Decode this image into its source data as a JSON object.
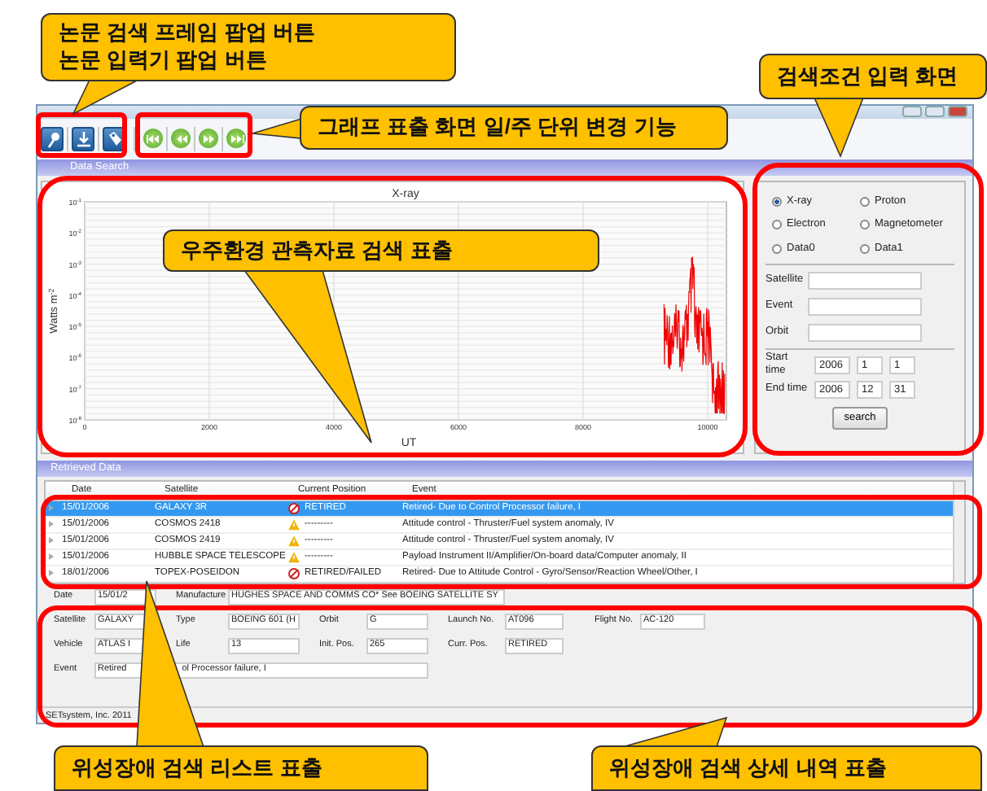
{
  "callouts": [
    {
      "lines": [
        "논문 검색 프레임 팝업 버튼",
        "논문 입력기 팝업 버튼"
      ]
    },
    {
      "lines": [
        "그래프 표출 화면 일/주 단위 변경 기능"
      ]
    },
    {
      "lines": [
        "검색조건 입력 화면"
      ]
    },
    {
      "lines": [
        "우주환경 관측자료 검색 표출"
      ]
    },
    {
      "lines": [
        "위성장애 검색 리스트 표출"
      ]
    },
    {
      "lines": [
        "위성장애 검색 상세 내역 표출"
      ]
    }
  ],
  "toolbar": [
    {
      "kind": "pin"
    },
    {
      "kind": "download"
    },
    {
      "kind": "tag"
    },
    {
      "kind": "first"
    },
    {
      "kind": "previous"
    },
    {
      "kind": "next"
    },
    {
      "kind": "last"
    }
  ],
  "data_search": {
    "header": "Data Search",
    "chart": {
      "title": "X-ray",
      "xlabel": "UT",
      "ylabel": "Watts m$^{-2}$",
      "xticks": [
        "0",
        "2000",
        "4000",
        "6000",
        "8000",
        "10000"
      ],
      "yticks": [
        "10$^{-1}$",
        "10$^{-2}$",
        "10$^{-3}$",
        "10$^{-4}$",
        "10$^{-5}$",
        "10$^{-6}$",
        "10$^{-7}$",
        "10$^{-8}$"
      ]
    },
    "search_panel": {
      "options": [
        {
          "label": "X-ray",
          "selected": true
        },
        {
          "label": "Proton",
          "selected": false
        },
        {
          "label": "Electron",
          "selected": false
        },
        {
          "label": "Magnetometer",
          "selected": false
        },
        {
          "label": "Data0",
          "selected": false
        },
        {
          "label": "Data1",
          "selected": false
        }
      ],
      "fields": [
        {
          "label": "Satellite"
        },
        {
          "label": "Event"
        },
        {
          "label": "Orbit"
        }
      ],
      "start_time": {
        "label": "Start time",
        "values": [
          "2006",
          "1",
          "1"
        ]
      },
      "end_time": {
        "label": "End time",
        "values": [
          "2006",
          "12",
          "31"
        ]
      },
      "button": "search"
    }
  },
  "retrieved": {
    "header": "Retrieved Data",
    "columns": [
      "Date",
      "Satellite",
      "Current Position",
      "Event"
    ],
    "rows": [
      {
        "date": "15/01/2006",
        "satellite": "GALAXY 3R",
        "kind": "no-entry",
        "position": "RETIRED",
        "event": "Retired- Due to Control Processor failure, I",
        "selected": true
      },
      {
        "date": "15/01/2006",
        "satellite": "COSMOS 2418",
        "kind": "warning",
        "position": "---------",
        "event": "Attitude control - Thruster/Fuel system anomaly, IV",
        "selected": false
      },
      {
        "date": "15/01/2006",
        "satellite": "COSMOS 2419",
        "kind": "warning",
        "position": "---------",
        "event": "Attitude control - Thruster/Fuel system anomaly, IV",
        "selected": false
      },
      {
        "date": "15/01/2006",
        "satellite": "HUBBLE SPACE TELESCOPE",
        "kind": "warning",
        "position": "---------",
        "event": "Payload Instrument II/Amplifier/On-board data/Computer anomaly, II",
        "selected": false
      },
      {
        "date": "18/01/2006",
        "satellite": "TOPEX-POSEIDON",
        "kind": "no-entry",
        "position": "RETIRED/FAILED",
        "event": "Retired- Due to Attitude Control - Gyro/Sensor/Reaction Wheel/Other, I",
        "selected": false
      }
    ]
  },
  "details": [
    [
      {
        "label": "Date",
        "value": [
          "15/01/2"
        ]
      },
      {
        "label": "Manufacture",
        "value": [
          "HUGHES SPACE AND COMMS CO* See BOEING SATELLITE SY"
        ]
      }
    ],
    [
      {
        "label": "Satellite",
        "value": [
          "GALAXY"
        ]
      },
      {
        "label": "Type",
        "value": [
          "BOEING 601 (H"
        ]
      },
      {
        "label": "Orbit",
        "value": [
          "G"
        ]
      },
      {
        "label": "Launch No.",
        "value": [
          "AT096"
        ]
      },
      {
        "label": "Flight No.",
        "value": [
          "AC-120"
        ]
      }
    ],
    [
      {
        "label": "Vehicle",
        "value": [
          "ATLAS I"
        ]
      },
      {
        "label": "Life",
        "value": [
          "13"
        ]
      },
      {
        "label": "Init. Pos.",
        "value": [
          "265"
        ]
      },
      {
        "label": "Curr. Pos.",
        "value": [
          "RETIRED"
        ]
      }
    ],
    [
      {
        "label": "Event",
        "value": [
          "Retired",
          "ol Processor failure, I"
        ]
      }
    ]
  ],
  "status_bar": "SETsystem, Inc. 2011"
}
